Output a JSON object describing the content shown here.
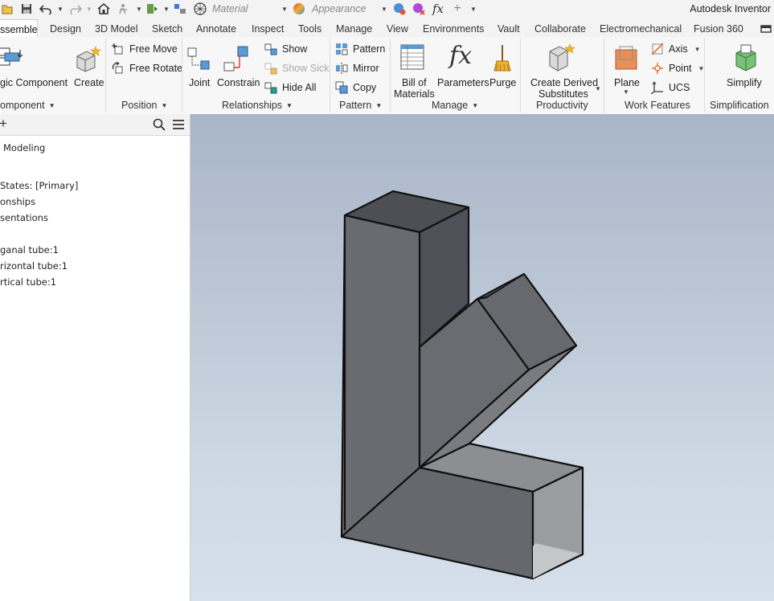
{
  "app": {
    "title": "Autodesk Inventor"
  },
  "quick_access": {
    "material_value": "Material",
    "appearance_value": "Appearance",
    "fx_glyph": "fx"
  },
  "tabs": [
    {
      "label": "ssemble",
      "active": true
    },
    {
      "label": "Design"
    },
    {
      "label": "3D Model"
    },
    {
      "label": "Sketch"
    },
    {
      "label": "Annotate"
    },
    {
      "label": "Inspect"
    },
    {
      "label": "Tools"
    },
    {
      "label": "Manage"
    },
    {
      "label": "View"
    },
    {
      "label": "Environments"
    },
    {
      "label": "Vault"
    },
    {
      "label": "Collaborate"
    },
    {
      "label": "Electromechanical"
    },
    {
      "label": "Fusion 360"
    }
  ],
  "ribbon": {
    "component": {
      "place_label": "gic Component",
      "create_label": "Create",
      "panel": "omponent"
    },
    "position": {
      "free_move": "Free Move",
      "free_rotate": "Free Rotate",
      "panel": "Position"
    },
    "relationships": {
      "joint": "Joint",
      "constrain": "Constrain",
      "show": "Show",
      "show_sick": "Show Sick",
      "hide_all": "Hide All",
      "panel": "Relationships"
    },
    "pattern": {
      "pattern": "Pattern",
      "mirror": "Mirror",
      "copy": "Copy",
      "panel": "Pattern"
    },
    "manage": {
      "bom_line1": "Bill of",
      "bom_line2": "Materials",
      "parameters": "Parameters",
      "purge": "Purge",
      "panel": "Manage",
      "fx_glyph": "fx"
    },
    "productivity": {
      "derived_line1": "Create Derived",
      "derived_line2": "Substitutes",
      "panel": "Productivity"
    },
    "work_features": {
      "plane": "Plane",
      "axis": "Axis",
      "point": "Point",
      "ucs": "UCS",
      "panel": "Work Features"
    },
    "simplification": {
      "simplify": "Simplify",
      "panel": "Simplification"
    }
  },
  "browser": {
    "add_glyph": "+",
    "items": [
      "Modeling",
      "States: [Primary]",
      "onships",
      "sentations",
      "ganal tube:1",
      "rizontal  tube:1",
      "rtical  tube:1"
    ]
  },
  "colors": {
    "accent": "#0696d7",
    "viewport_top": "#a9b6c8",
    "viewport_bottom": "#d6e0ec"
  }
}
